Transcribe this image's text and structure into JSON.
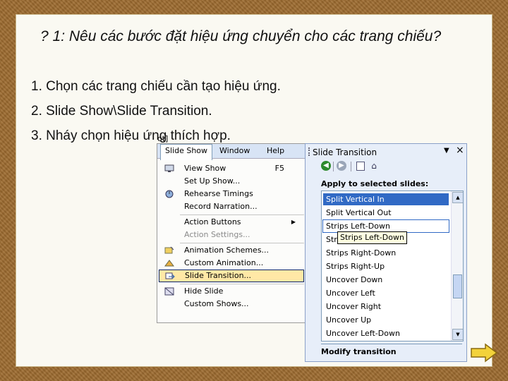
{
  "slide": {
    "question": "? 1: Nêu các bước đặt hiệu ứng chuyển cho các trang chiếu?",
    "steps": [
      "1. Chọn các trang chiếu cần tạo hiệu ứng.",
      "2. Slide Show\\Slide Transition.",
      "3. Nháy chọn hiệu ứng thích hợp."
    ]
  },
  "menu": {
    "fragment": "ot]",
    "bar": {
      "slide_show": "Slide Show",
      "window": "Window",
      "help": "Help"
    },
    "items": [
      {
        "label": "View Show",
        "shortcut": "F5",
        "icon": "projector-icon"
      },
      {
        "label": "Set Up Show...",
        "icon": ""
      },
      {
        "label": "Rehearse Timings",
        "icon": "rehearse-icon"
      },
      {
        "label": "Record Narration...",
        "icon": ""
      },
      {
        "label": "Action Buttons",
        "icon": "",
        "submenu": true
      },
      {
        "label": "Action Settings...",
        "icon": "",
        "disabled": true
      },
      {
        "label": "Animation Schemes...",
        "icon": "animation-schemes-icon"
      },
      {
        "label": "Custom Animation...",
        "icon": "custom-animation-icon"
      },
      {
        "label": "Slide Transition...",
        "icon": "slide-transition-icon",
        "selected": true
      },
      {
        "label": "Hide Slide",
        "icon": "hide-slide-icon"
      },
      {
        "label": "Custom Shows...",
        "icon": ""
      }
    ]
  },
  "pane": {
    "title": "Slide Transition",
    "apply_label": "Apply to selected slides:",
    "list": [
      "Split Vertical In",
      "Split Vertical Out",
      "Strips Left-Down",
      "Strips Left-Up",
      "Strips Right-Down",
      "Strips Right-Up",
      "Uncover Down",
      "Uncover Left",
      "Uncover Right",
      "Uncover Up",
      "Uncover Left-Down"
    ],
    "list_prefix_4": "Str",
    "tooltip": "Strips Left-Down",
    "modify_label": "Modify transition"
  },
  "colors": {
    "border": "#9c6a2e",
    "slide_bg": "#faf9f2",
    "menu_highlight": "#ffe8a6",
    "list_selected": "#316ac5",
    "next_arrow": "#f3d23a"
  }
}
